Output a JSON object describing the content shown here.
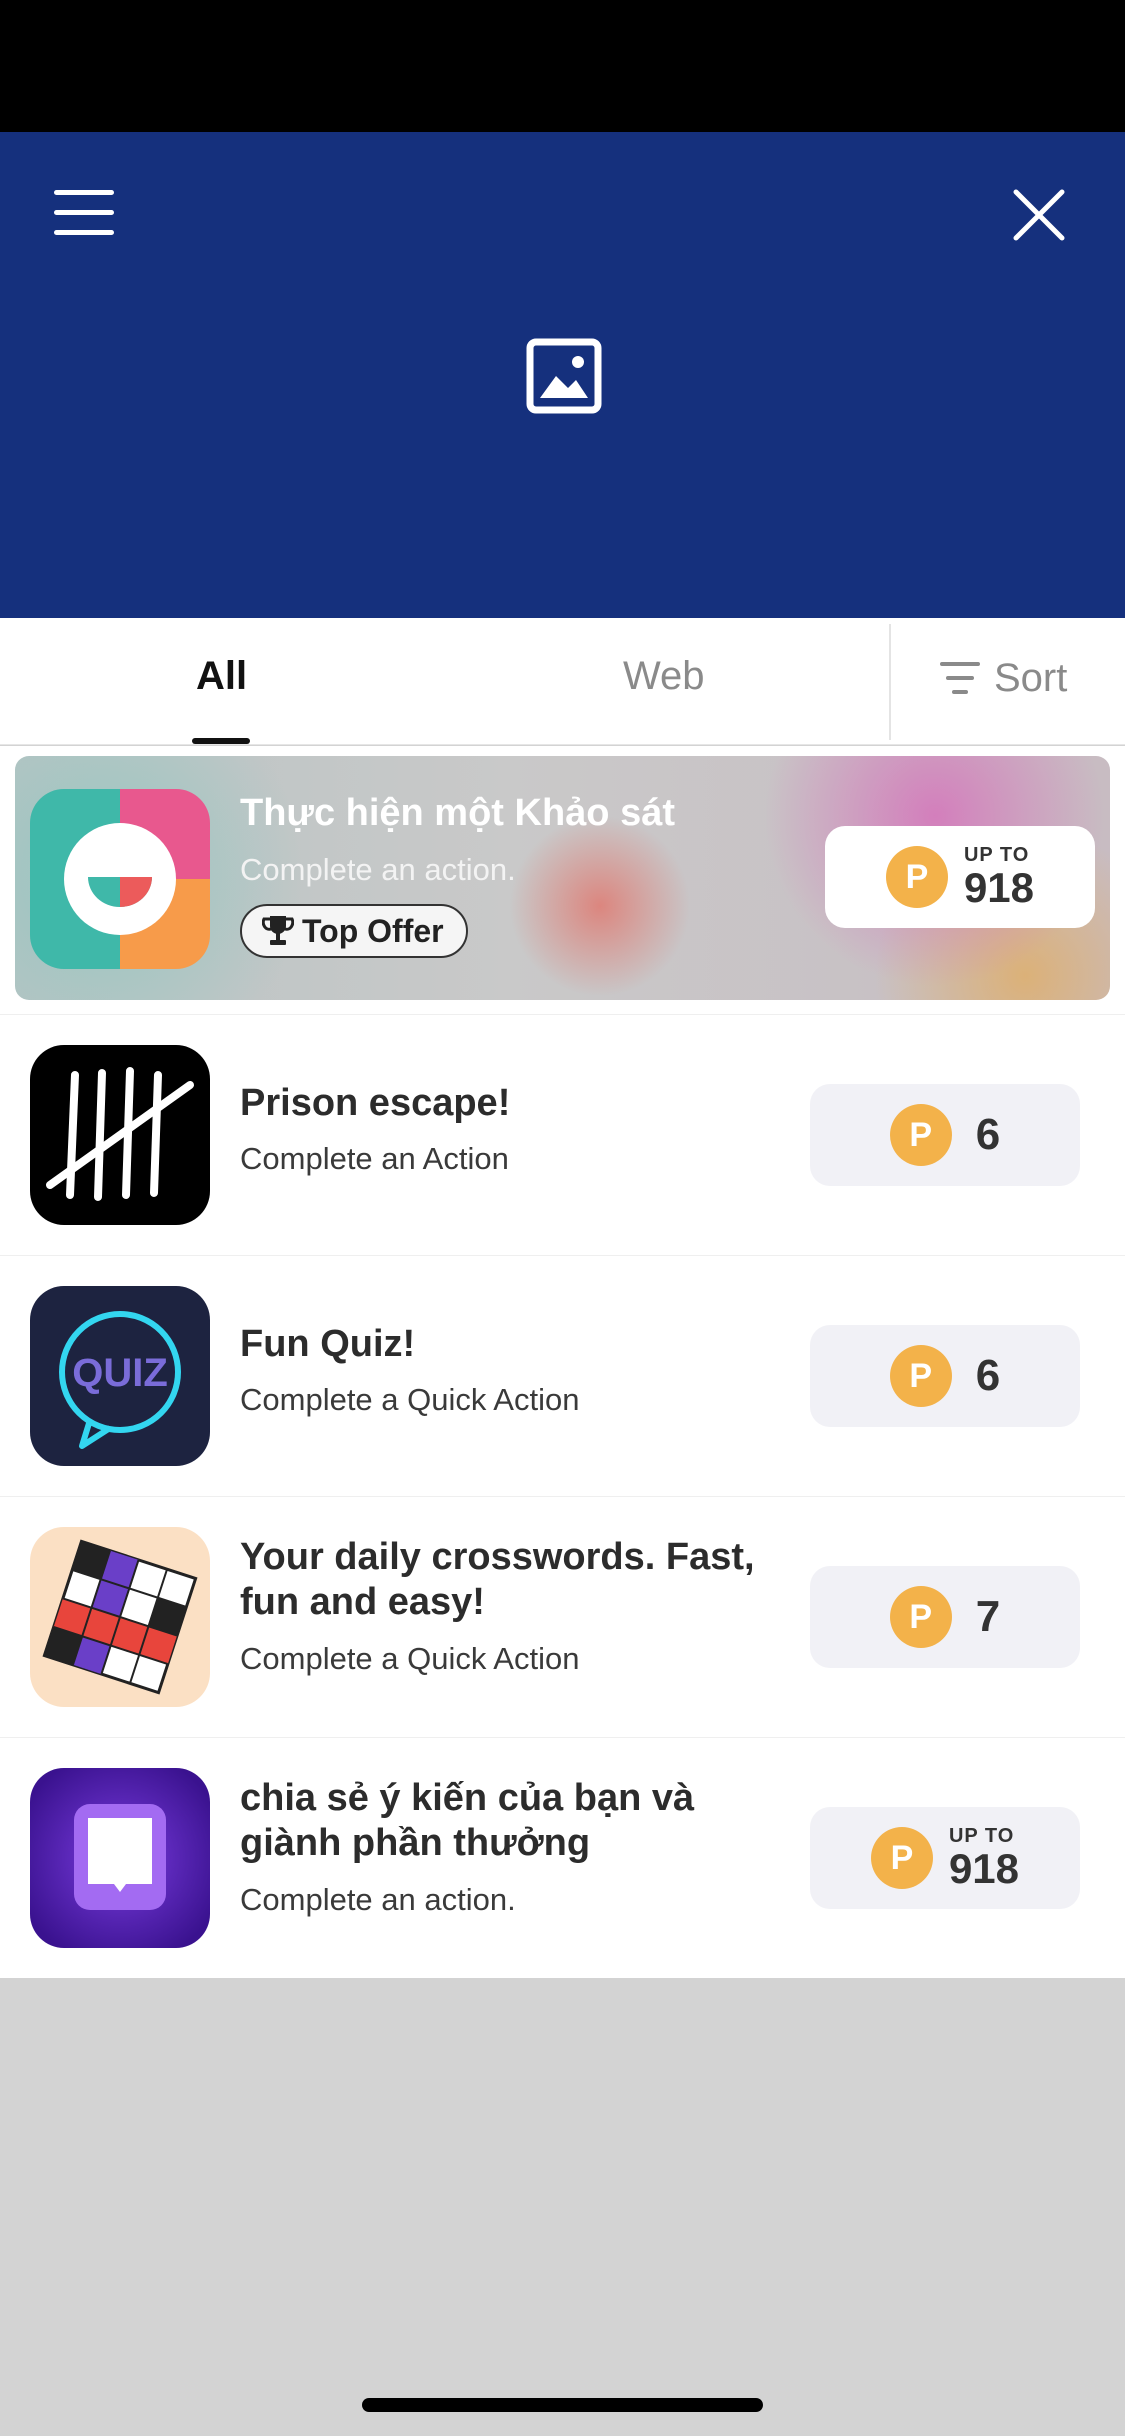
{
  "header": {
    "menu_icon": "hamburger-menu-icon",
    "close_icon": "close-icon",
    "logo_icon": "image-placeholder-icon",
    "background_color": "#15307d"
  },
  "tabs": {
    "items": [
      {
        "label": "All",
        "selected": true
      },
      {
        "label": "Web",
        "selected": false
      }
    ],
    "sort_label": "Sort"
  },
  "featured_offer": {
    "title": "Thực hiện một Khảo sát",
    "subtitle": "Complete an action.",
    "badge": "Top Offer",
    "reward": {
      "prefix": "UP TO",
      "amount": "918",
      "coin_symbol": "P"
    }
  },
  "offers": [
    {
      "title": "Prison escape!",
      "subtitle": "Complete an Action",
      "reward": {
        "amount": "6",
        "coin_symbol": "P"
      }
    },
    {
      "title": "Fun Quiz!",
      "subtitle": "Complete a Quick Action",
      "icon_text": "QUIZ",
      "reward": {
        "amount": "6",
        "coin_symbol": "P"
      }
    },
    {
      "title": "Your daily crosswords. Fast, fun and easy!",
      "subtitle": "Complete a Quick Action",
      "reward": {
        "amount": "7",
        "coin_symbol": "P"
      }
    },
    {
      "title": "chia sẻ ý kiến của bạn và giành phần thưởng",
      "subtitle": "Complete an action.",
      "reward": {
        "prefix": "UP TO",
        "amount": "918",
        "coin_symbol": "P"
      }
    }
  ],
  "colors": {
    "coin": "#f3b24a",
    "reward_pill": "#f1f1f6",
    "text_primary": "#2c2c2c"
  }
}
